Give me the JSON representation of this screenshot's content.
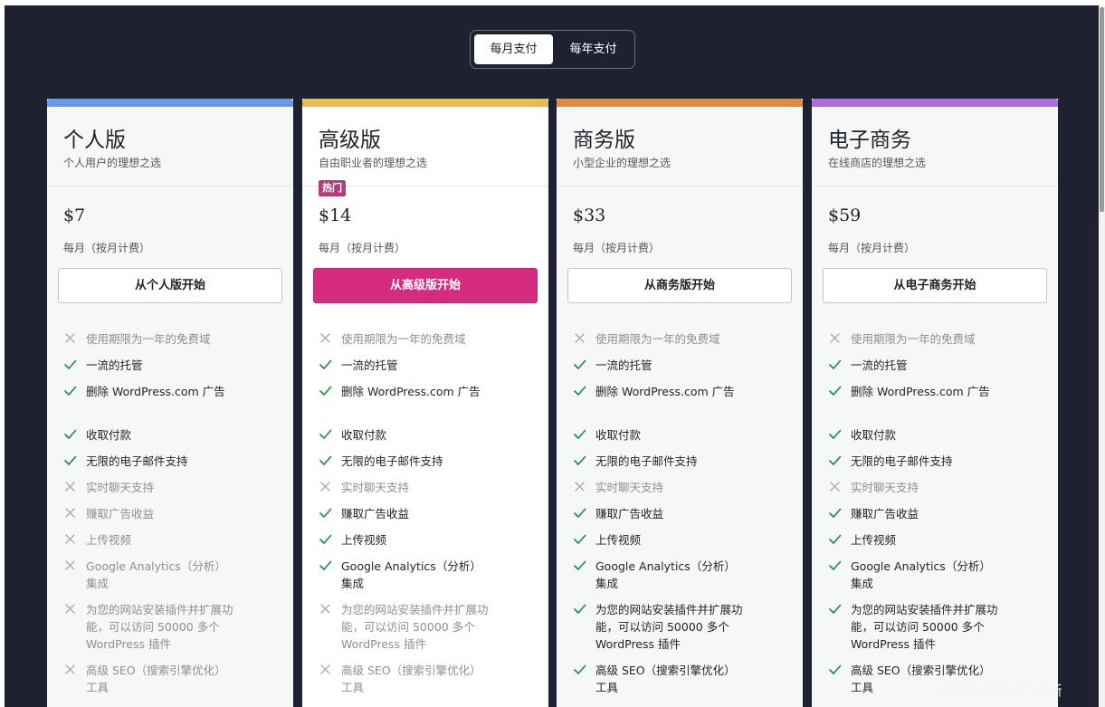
{
  "billing_toggle": {
    "monthly_label": "每月支付",
    "yearly_label": "每年支付",
    "selected": "monthly"
  },
  "colors": {
    "page_background": "#1e2230",
    "personal_accent": "#6b97ef",
    "premium_accent": "#e5be4a",
    "business_accent": "#e68a39",
    "ecommerce_accent": "#a96be4",
    "primary_button": "#d52c82",
    "badge": "#b53b7e",
    "check_icon": "#1f8f42",
    "cross_icon": "#a7aaad"
  },
  "plans": [
    {
      "name": "个人版",
      "tagline": "个人用户的理想之选",
      "price": "$7",
      "period": "每月（按月计费）",
      "cta": "从个人版开始",
      "features": [
        {
          "text": "使用期限为一年的免费域",
          "included": false
        },
        {
          "text": "一流的托管",
          "included": true
        },
        {
          "text": "删除 WordPress.com 广告",
          "included": true
        },
        {
          "text": "收取付款",
          "included": true
        },
        {
          "text": "无限的电子邮件支持",
          "included": true
        },
        {
          "text": "实时聊天支持",
          "included": false
        },
        {
          "text": "赚取广告收益",
          "included": false
        },
        {
          "text": "上传视频",
          "included": false
        },
        {
          "text": "Google Analytics（分析）集成",
          "included": false
        },
        {
          "text": "为您的网站安装插件并扩展功能，可以访问 50000 多个 WordPress 插件",
          "included": false
        },
        {
          "text": "高级 SEO（搜索引擎优化）工具",
          "included": false
        }
      ]
    },
    {
      "name": "高级版",
      "tagline": "自由职业者的理想之选",
      "badge": "热门",
      "price": "$14",
      "period": "每月（按月计费）",
      "cta": "从高级版开始",
      "features": [
        {
          "text": "使用期限为一年的免费域",
          "included": false
        },
        {
          "text": "一流的托管",
          "included": true
        },
        {
          "text": "删除 WordPress.com 广告",
          "included": true
        },
        {
          "text": "收取付款",
          "included": true
        },
        {
          "text": "无限的电子邮件支持",
          "included": true
        },
        {
          "text": "实时聊天支持",
          "included": false
        },
        {
          "text": "赚取广告收益",
          "included": true
        },
        {
          "text": "上传视频",
          "included": true
        },
        {
          "text": "Google Analytics（分析）集成",
          "included": true
        },
        {
          "text": "为您的网站安装插件并扩展功能，可以访问 50000 多个 WordPress 插件",
          "included": false
        },
        {
          "text": "高级 SEO（搜索引擎优化）工具",
          "included": false
        }
      ]
    },
    {
      "name": "商务版",
      "tagline": "小型企业的理想之选",
      "price": "$33",
      "period": "每月（按月计费）",
      "cta": "从商务版开始",
      "features": [
        {
          "text": "使用期限为一年的免费域",
          "included": false
        },
        {
          "text": "一流的托管",
          "included": true
        },
        {
          "text": "删除 WordPress.com 广告",
          "included": true
        },
        {
          "text": "收取付款",
          "included": true
        },
        {
          "text": "无限的电子邮件支持",
          "included": true
        },
        {
          "text": "实时聊天支持",
          "included": false
        },
        {
          "text": "赚取广告收益",
          "included": true
        },
        {
          "text": "上传视频",
          "included": true
        },
        {
          "text": "Google Analytics（分析）集成",
          "included": true
        },
        {
          "text": "为您的网站安装插件并扩展功能，可以访问 50000 多个 WordPress 插件",
          "included": true
        },
        {
          "text": "高级 SEO（搜索引擎优化）工具",
          "included": true
        }
      ]
    },
    {
      "name": "电子商务",
      "tagline": "在线商店的理想之选",
      "price": "$59",
      "period": "每月（按月计费）",
      "cta": "从电子商务开始",
      "features": [
        {
          "text": "使用期限为一年的免费域",
          "included": false
        },
        {
          "text": "一流的托管",
          "included": true
        },
        {
          "text": "删除 WordPress.com 广告",
          "included": true
        },
        {
          "text": "收取付款",
          "included": true
        },
        {
          "text": "无限的电子邮件支持",
          "included": true
        },
        {
          "text": "实时聊天支持",
          "included": false
        },
        {
          "text": "赚取广告收益",
          "included": true
        },
        {
          "text": "上传视频",
          "included": true
        },
        {
          "text": "Google Analytics（分析）集成",
          "included": true
        },
        {
          "text": "为您的网站安装插件并扩展功能，可以访问 50000 多个 WordPress 插件",
          "included": true
        },
        {
          "text": "高级 SEO（搜索引擎优化）工具",
          "included": true
        }
      ]
    }
  ],
  "watermark": "CSDN @低调的维斯"
}
